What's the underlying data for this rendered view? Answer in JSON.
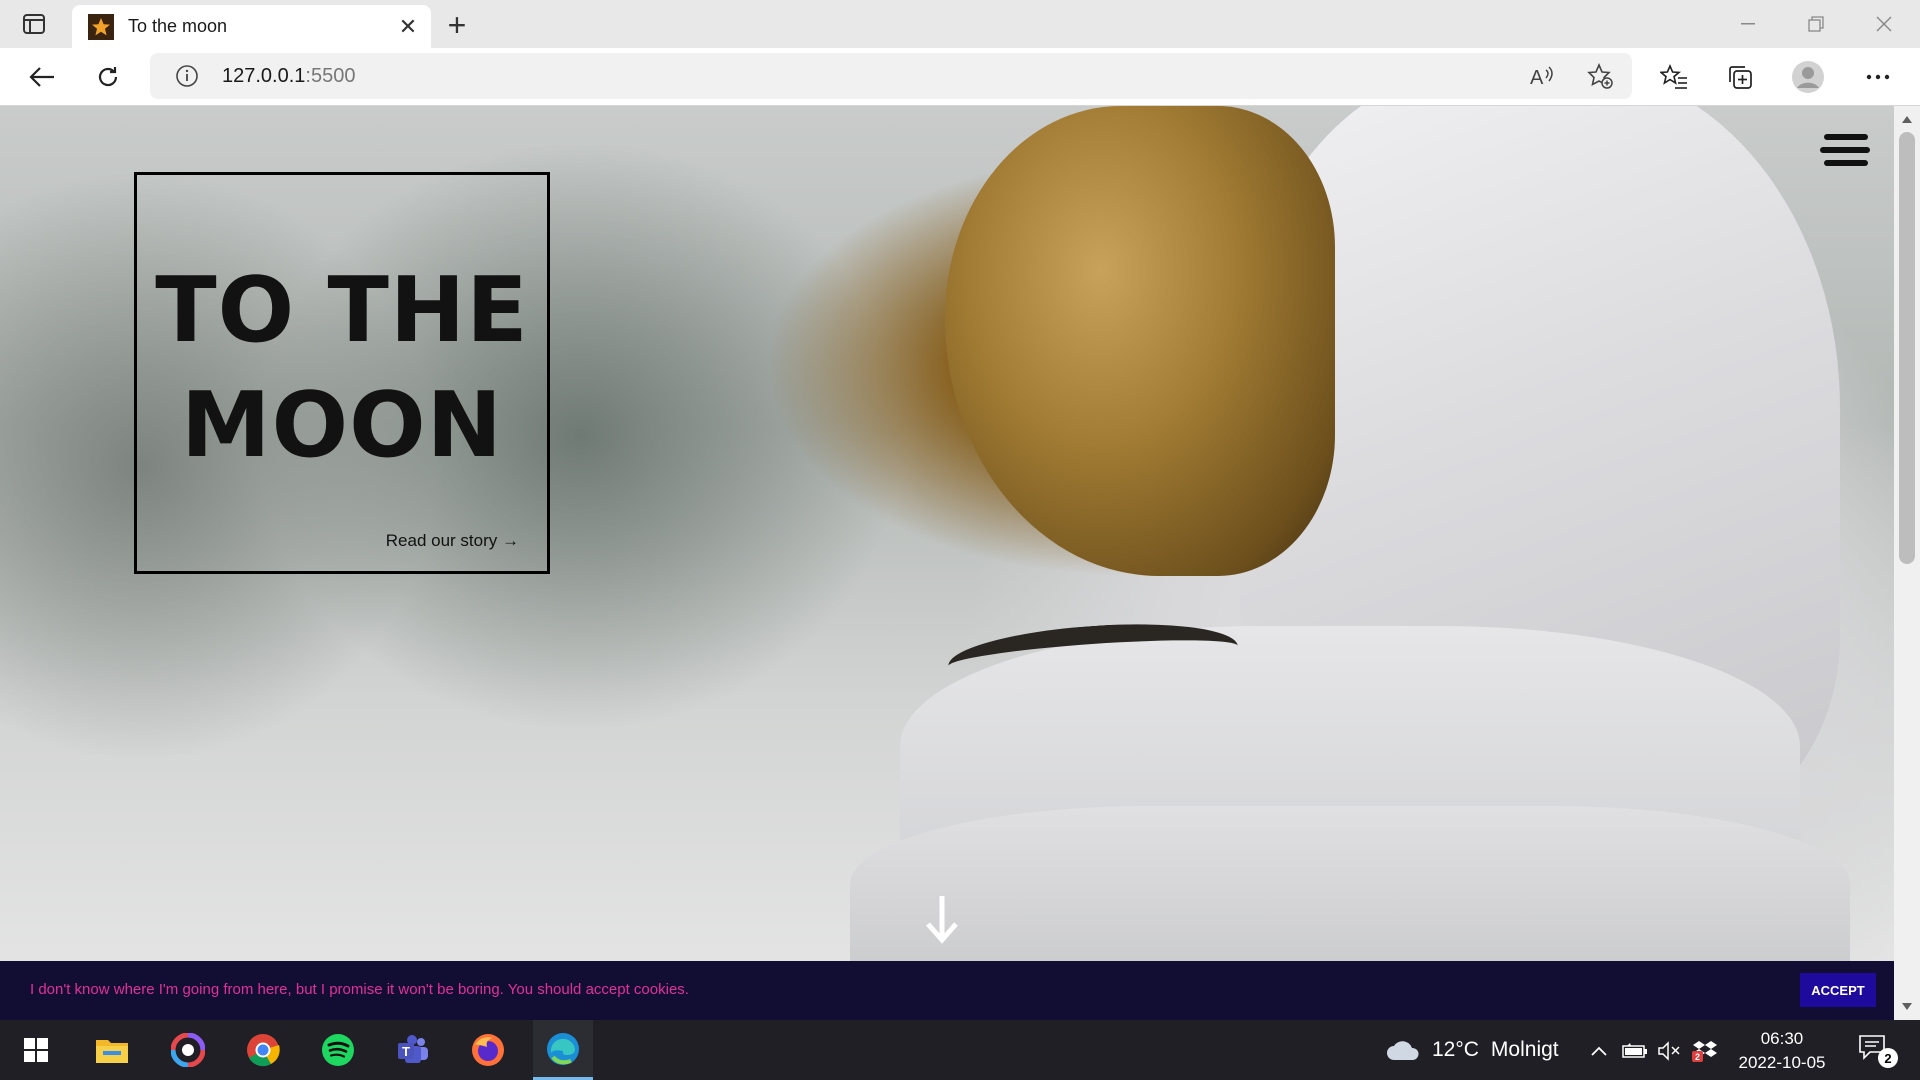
{
  "browser": {
    "tab": {
      "title": "To the moon",
      "favicon": "star-icon",
      "close_label": "✕"
    },
    "new_tab_label": "+",
    "address": {
      "host": "127.0.0.1",
      "port": ":5500"
    }
  },
  "page": {
    "hero": {
      "title_line1": "TO THE",
      "title_line2": "MOON",
      "link_label": "Read our story →"
    },
    "cookie": {
      "message": "I don't know where I'm going from here, but I promise it won't be boring. You should accept cookies.",
      "accept_label": "ACCEPT"
    },
    "colors": {
      "cookie_bg": "#120d33",
      "cookie_text": "#e0309a",
      "accept_bg": "#1f0a9e"
    }
  },
  "taskbar": {
    "apps": [
      "windows-start",
      "file-explorer",
      "app-swirl",
      "chrome",
      "spotify",
      "teams",
      "firefox",
      "edge"
    ],
    "weather": {
      "temp": "12°C",
      "condition": "Molnigt"
    },
    "clock": {
      "time": "06:30",
      "date": "2022-10-05"
    },
    "notifications": "2"
  }
}
